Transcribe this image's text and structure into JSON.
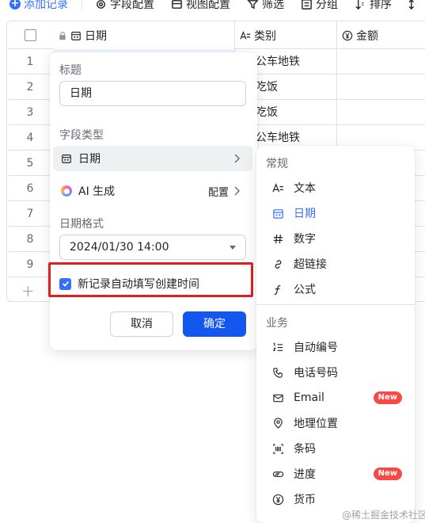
{
  "toolbar": {
    "add_record": "添加记录",
    "field_config": "字段配置",
    "view_config": "视图配置",
    "filter": "筛选",
    "group": "分组",
    "sort": "排序"
  },
  "table": {
    "columns": [
      "日期",
      "类别",
      "金额"
    ],
    "rows": [
      {
        "num": "1",
        "category": "公车地铁"
      },
      {
        "num": "2",
        "category": "吃饭"
      },
      {
        "num": "3",
        "category": "吃饭"
      },
      {
        "num": "4",
        "category": "公车地铁"
      },
      {
        "num": "5",
        "category": ""
      },
      {
        "num": "6",
        "category": ""
      },
      {
        "num": "7",
        "category": ""
      },
      {
        "num": "8",
        "category": ""
      },
      {
        "num": "9",
        "category": ""
      }
    ]
  },
  "popup": {
    "title_label": "标题",
    "title_value": "日期",
    "field_type_label": "字段类型",
    "field_type_value": "日期",
    "ai_label": "AI 生成",
    "ai_config": "配置",
    "date_format_label": "日期格式",
    "date_format_value": "2024/01/30 14:00",
    "autofill_label": "新记录自动填写创建时间",
    "autofill_checked": true,
    "cancel": "取消",
    "confirm": "确定"
  },
  "dropdown": {
    "group_general": "常规",
    "general_items": [
      {
        "label": "文本",
        "icon": "text-icon"
      },
      {
        "label": "日期",
        "icon": "calendar-icon",
        "selected": true
      },
      {
        "label": "数字",
        "icon": "hash-icon"
      },
      {
        "label": "超链接",
        "icon": "link-icon"
      },
      {
        "label": "公式",
        "icon": "formula-icon"
      }
    ],
    "group_business": "业务",
    "business_items": [
      {
        "label": "自动编号",
        "icon": "auto-number-icon"
      },
      {
        "label": "电话号码",
        "icon": "phone-icon"
      },
      {
        "label": "Email",
        "icon": "mail-icon",
        "badge": "New"
      },
      {
        "label": "地理位置",
        "icon": "location-icon"
      },
      {
        "label": "条码",
        "icon": "barcode-icon"
      },
      {
        "label": "进度",
        "icon": "progress-icon",
        "badge": "New"
      },
      {
        "label": "货币",
        "icon": "currency-icon"
      }
    ]
  },
  "watermark": "@稀土掘金技术社区",
  "colors": {
    "accent": "#3370ff",
    "confirm_button": "#1456f0",
    "highlight_border": "#e02020",
    "new_badge": "#f54a45"
  }
}
